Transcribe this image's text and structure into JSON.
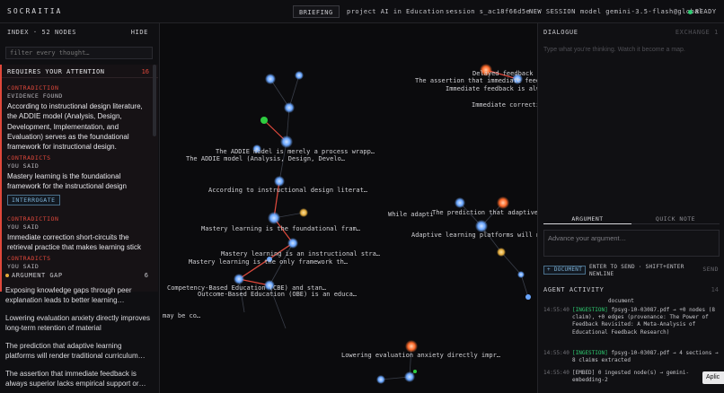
{
  "app": {
    "brand": "SOCRAITIA"
  },
  "topbar": {
    "briefing": "BRIEFING",
    "project": "project AI in Education ·",
    "session": "session s_ac18f66d5e",
    "new_session": "NEW SESSION",
    "model": "model gemini-3.5-flash@global",
    "status": "READY"
  },
  "sidebar": {
    "title": "INDEX · 52 NODES",
    "hide": "HIDE",
    "filter_placeholder": "filter every thought…",
    "attention": {
      "title": "REQUIRES YOUR ATTENTION",
      "count": "16",
      "items": [
        {
          "tag": "CONTRADICTION",
          "sub": "EVIDENCE FOUND",
          "text": "According to instructional design literature, the ADDIE model (Analysis, Design, Development, Implementation, and Evaluation) serves as the foundational framework for instructional design."
        },
        {
          "tag": "CONTRADICTS",
          "sub": "YOU SAID",
          "text": "Mastery learning is the foundational framework for the instructional design"
        },
        {
          "tag": "CONTRADICTION",
          "sub": "YOU SAID",
          "text": "Immediate correction short-circuits the retrieval practice that makes learning stick"
        },
        {
          "tag": "CONTRADICTS",
          "sub": "YOU SAID"
        }
      ],
      "interrogate": "INTERROGATE"
    },
    "gap": {
      "title": "ARGUMENT GAP",
      "count": "6",
      "items": [
        "Exposing knowledge gaps through peer explanation leads to better learning…",
        "Lowering evaluation anxiety directly improves long-term retention of material",
        "The prediction that adaptive learning platforms will render traditional curriculum…",
        "The assertion that immediate feedback is always superior lacks empirical support or…"
      ]
    }
  },
  "graph": {
    "labels": [
      "Delayed feedback p",
      "The assertion that immediate feedbac",
      "Immediate feedback is alway",
      "Immediate correctio",
      "The ADDIE model is merely a process wrapp…",
      "The ADDIE model (Analysis, Design, Develo…",
      "According to instructional design literat…",
      "While adapti",
      "The prediction that adaptive le",
      "Adaptive learning platforms will make",
      "Mastery learning is the foundational fram…",
      "Mastery learning is an instructional stra…",
      "Mastery learning is the only framework th…",
      "Competency-Based Education (CBE) and stan…",
      "Outcome-Based Education (OBE) is an educa…",
      "may be co…",
      "Lowering evaluation anxiety directly impr…"
    ]
  },
  "dialogue": {
    "title": "DIALOGUE",
    "exchange": "EXCHANGE 1",
    "placeholder": "Type what you're thinking. Watch it become a map.",
    "tabs": [
      "ARGUMENT",
      "QUICK NOTE"
    ],
    "input_placeholder": "Advance your argument…",
    "document_btn": "+ DOCUMENT",
    "send_hint": "ENTER TO SEND · SHIFT+ENTER NEWLINE",
    "send": "SEND"
  },
  "activity": {
    "title": "AGENT ACTIVITY",
    "count": "14",
    "rows": [
      {
        "time": "",
        "tag": "",
        "body": "document"
      },
      {
        "time": "14:55:40",
        "tag": "[INGESTION]",
        "body": "fpsyg-10-03087.pdf → +0 nodes (8 claim), +0 edges (provenance: The Power of Feedback Revisited: A Meta-Analysis of Educational Feedback Research)"
      },
      {
        "time": "14:55:40",
        "tag": "[INGESTION]",
        "body": "fpsyg-10-03087.pdf → 4 sections → 8 claims extracted"
      },
      {
        "time": "14:55:40",
        "tag": "[EMBED]",
        "body": "0 ingested node(s) → gemini-embedding-2"
      }
    ]
  },
  "apply": "Aplic",
  "colors": {
    "accent_red": "#e0483b",
    "accent_green": "#2ecc71",
    "accent_blue": "#7fb3d8",
    "node_blue": "#7fb6ff",
    "node_orange": "#ff7a3d",
    "node_amber": "#e0a93b"
  }
}
